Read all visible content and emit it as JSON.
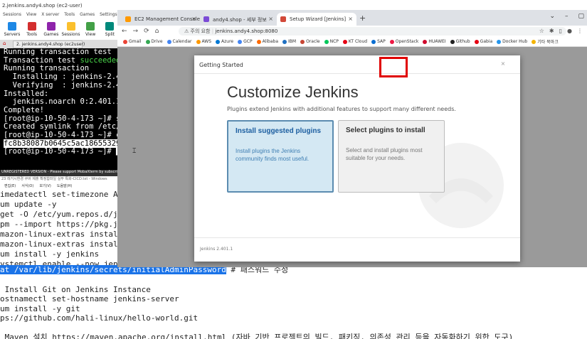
{
  "terminal": {
    "title": "2.jenkins.andy4.shop (ec2-user)",
    "menu": [
      "Sessions",
      "View",
      "X server",
      "Tools",
      "Games",
      "Settings",
      "Macros"
    ],
    "toolbar": [
      "Servers",
      "Tools",
      "Games",
      "Sessions",
      "View",
      "Split"
    ],
    "tab_label": "2. jenkins.andy4.shop (ec2user)",
    "lines": [
      {
        "text": "Running transaction test",
        "cls": ""
      },
      {
        "text": "Transaction test ",
        "suffix": "succeeded",
        "cls": ""
      },
      {
        "text": "Running transaction",
        "cls": ""
      },
      {
        "text": "  Installing : jenkins-2.401.",
        "cls": ""
      },
      {
        "text": "  Verifying  : jenkins-2.401.",
        "cls": ""
      },
      {
        "text": "",
        "cls": ""
      },
      {
        "text": "Installed:",
        "cls": ""
      },
      {
        "text": "  jenkins.noarch 0:2.401.1-1.",
        "cls": ""
      },
      {
        "text": "",
        "cls": ""
      },
      {
        "text": "Complete!",
        "cls": ""
      },
      {
        "text": "[root@ip-10-50-4-173 ~]# syst",
        "cls": ""
      },
      {
        "text": "Created symlink from /etc/sys",
        "cls": ""
      },
      {
        "text": "[root@ip-10-50-4-173 ~]# cat",
        "cls": ""
      },
      {
        "text": "fc8b38087b0645c5ac18655329a5e",
        "cls": "sel"
      },
      {
        "text": "[root@ip-10-50-4-173 ~]# ",
        "cls": ""
      }
    ],
    "footer": "UNREGISTERED VERSION - Please support MobaXterm by subscribing to the professional edition"
  },
  "notepad": {
    "title": "23 레거시환경 쿠버 제출 확정합파일 실무 특화-CICD.txt - Windows",
    "menu": [
      "편집(E)",
      "서식(O)",
      "보기(V)",
      "도움말(H)"
    ],
    "lines": [
      "imedatectl set-timezone Asia/S",
      "um update -y",
      "get -O /etc/yum.repos.d/jenkin",
      "pm --import https://pkg.jenkin",
      "mazon-linux-extras install epe",
      "mazon-linux-extras install -y",
      "um install -y jenkins",
      "ystemctl enable --now jenkins"
    ],
    "highlight_line": "at /var/lib/jenkins/secrets/initialAdminPassword",
    "highlight_suffix": " # 패스워드 수정",
    "lines2": [
      "",
      " Install Git on Jenkins Instance",
      "ostnamectl set-hostname jenkins-server",
      "um install -y git",
      "ps://github.com/hali-linux/hello-world.git",
      "",
      " Maven 설치 https://maven.apache.org/install.html (자바 기반 프로젝트의 빌드, 패키징, 의존성 관리 등을 자동화하기 위한 도구)"
    ]
  },
  "browser": {
    "tabs": [
      {
        "label": "EC2 Management Console",
        "color": "#f90"
      },
      {
        "label": "andy4.shop - 세부 정보",
        "color": "#7b4bd6"
      },
      {
        "label": "Setup Wizard [Jenkins]",
        "color": "#d24939"
      }
    ],
    "security_label": "주의 요함",
    "url": "jenkins.andy4.shop:8080",
    "bookmarks": [
      {
        "label": "Gmail",
        "color": "#ea4335"
      },
      {
        "label": "Drive",
        "color": "#34a853"
      },
      {
        "label": "Calendar",
        "color": "#4285f4"
      },
      {
        "label": "AWS",
        "color": "#f90"
      },
      {
        "label": "Azure",
        "color": "#0078d4"
      },
      {
        "label": "GCP",
        "color": "#4285f4"
      },
      {
        "label": "Alibaba",
        "color": "#ff6a00"
      },
      {
        "label": "IBM",
        "color": "#1f70c1"
      },
      {
        "label": "Oracle",
        "color": "#c74634"
      },
      {
        "label": "NCP",
        "color": "#03c75a"
      },
      {
        "label": "KT Cloud",
        "color": "#e60012"
      },
      {
        "label": "SAP",
        "color": "#0a6ed1"
      },
      {
        "label": "OpenStack",
        "color": "#ed1944"
      },
      {
        "label": "HUAWEI",
        "color": "#cf0a2c"
      },
      {
        "label": "Github",
        "color": "#222"
      },
      {
        "label": "Gabia",
        "color": "#e60012"
      },
      {
        "label": "Docker Hub",
        "color": "#2496ed"
      },
      {
        "label": "기타 북마크",
        "color": "#f4b400"
      }
    ]
  },
  "dialog": {
    "header": "Getting Started",
    "close": "×",
    "title": "Customize Jenkins",
    "subtitle": "Plugins extend Jenkins with additional features to support many different needs.",
    "card1_title": "Install suggested plugins",
    "card1_body": "Install plugins the Jenkins community finds most useful.",
    "card2_title": "Select plugins to install",
    "card2_body": "Select and install plugins most suitable for your needs.",
    "version": "Jenkins 2.401.1"
  },
  "colors": {
    "highlight": "#e00000",
    "card_selected": "#d4e8f3",
    "term_green": "#4ad64a"
  }
}
